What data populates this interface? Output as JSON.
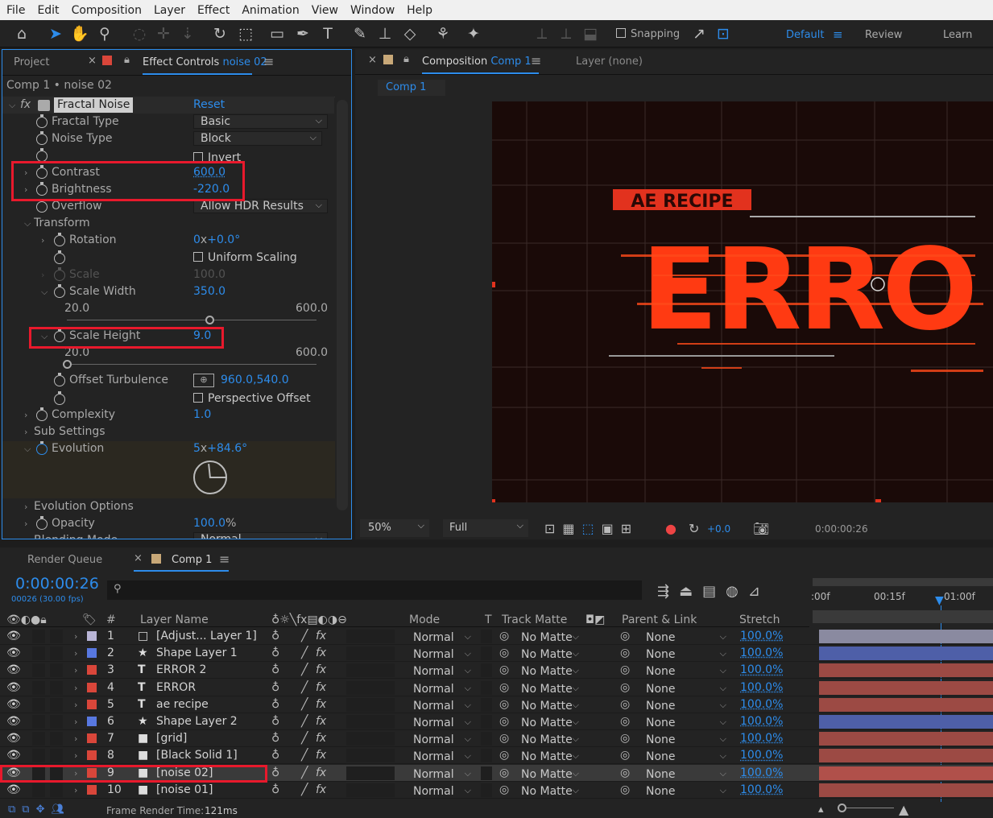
{
  "menu": [
    "File",
    "Edit",
    "Composition",
    "Layer",
    "Effect",
    "Animation",
    "View",
    "Window",
    "Help"
  ],
  "toolbar": {
    "snapping": "Snapping",
    "workspaces": [
      "Default",
      "Review",
      "Learn"
    ]
  },
  "effect_controls": {
    "project_tab": "Project",
    "tab_label": "Effect Controls",
    "tab_layer": "noise 02",
    "breadcrumb": "Comp 1 • noise 02",
    "effect_name": "Fractal Noise",
    "reset": "Reset",
    "fractal_type_label": "Fractal Type",
    "fractal_type_value": "Basic",
    "noise_type_label": "Noise Type",
    "noise_type_value": "Block",
    "invert_label": "Invert",
    "contrast_label": "Contrast",
    "contrast_value": "600.0",
    "brightness_label": "Brightness",
    "brightness_value": "-220.0",
    "overflow_label": "Overflow",
    "overflow_value": "Allow HDR Results",
    "transform_label": "Transform",
    "rotation_label": "Rotation",
    "rotation_value_a": "0",
    "rotation_value_x": "x",
    "rotation_value_b": "+0.0",
    "rotation_deg": "°",
    "uniform_scaling_label": "Uniform Scaling",
    "scale_label": "Scale",
    "scale_value": "100.0",
    "scale_width_label": "Scale Width",
    "scale_width_value": "350.0",
    "sw_min": "20.0",
    "sw_max": "600.0",
    "sw_level": 0.57,
    "scale_height_label": "Scale Height",
    "scale_height_value": "9.0",
    "sh_min": "20.0",
    "sh_max": "600.0",
    "sh_level": 0.0,
    "offset_label": "Offset Turbulence",
    "offset_value": "960.0,540.0",
    "perspective_label": "Perspective Offset",
    "complexity_label": "Complexity",
    "complexity_value": "1.0",
    "sub_settings_label": "Sub Settings",
    "evolution_label": "Evolution",
    "evolution_value_a": "5",
    "evolution_value_x": "x",
    "evolution_value_b": "+84.6",
    "evolution_deg": "°",
    "evolution_options_label": "Evolution Options",
    "opacity_label": "Opacity",
    "opacity_value": "100.0",
    "opacity_unit": "%",
    "blending_label": "Blending Mode",
    "blending_value": "Normal"
  },
  "composition": {
    "tab_label": "Composition",
    "tab_comp": "Comp 1",
    "layer_label": "Layer (none)",
    "crumb": "Comp 1",
    "viewer_text_small": "AE RECIPE",
    "viewer_text_big": "ERRO",
    "zoom": "50%",
    "resolution": "Full",
    "exposure": "+0.0",
    "timecode": "0:00:00:26"
  },
  "timeline": {
    "render_queue": "Render Queue",
    "comp_tab": "Comp 1",
    "timecode": "0:00:00:26",
    "frames": "00026 (30.00 fps)",
    "search_placeholder": "",
    "ruler": [
      ":00f",
      "00:15f",
      "01:00f"
    ],
    "headers": {
      "num": "#",
      "name": "Layer Name",
      "mode": "Mode",
      "t": "T",
      "matte": "Track Matte",
      "parent": "Parent & Link",
      "stretch": "Stretch"
    },
    "footer": "Frame Render Time:",
    "footer_ms": "121ms",
    "layers": [
      {
        "num": "1",
        "name": "[Adjust... Layer 1]",
        "icon": "□",
        "color": "#b9b5d6",
        "mode": "Normal",
        "matte": "No Matte",
        "parent": "None",
        "stretch": "100.0%",
        "bar": "#8a8aa0"
      },
      {
        "num": "2",
        "name": "Shape Layer 1",
        "icon": "★",
        "color": "#5878e0",
        "mode": "Normal",
        "matte": "No Matte",
        "parent": "None",
        "stretch": "100.0%",
        "bar": "#4e5fa8"
      },
      {
        "num": "3",
        "name": "ERROR 2",
        "icon": "T",
        "color": "#d9463a",
        "mode": "Normal",
        "matte": "No Matte",
        "parent": "None",
        "stretch": "100.0%",
        "bar": "#9c4a44"
      },
      {
        "num": "4",
        "name": "ERROR",
        "icon": "T",
        "color": "#d9463a",
        "mode": "Normal",
        "matte": "No Matte",
        "parent": "None",
        "stretch": "100.0%",
        "bar": "#9c4a44"
      },
      {
        "num": "5",
        "name": "ae recipe",
        "icon": "T",
        "color": "#d9463a",
        "mode": "Normal",
        "matte": "No Matte",
        "parent": "None",
        "stretch": "100.0%",
        "bar": "#9c4a44"
      },
      {
        "num": "6",
        "name": "Shape Layer 2",
        "icon": "★",
        "color": "#5878e0",
        "mode": "Normal",
        "matte": "No Matte",
        "parent": "None",
        "stretch": "100.0%",
        "bar": "#4e5fa8"
      },
      {
        "num": "7",
        "name": "[grid]",
        "icon": "■",
        "color": "#d9463a",
        "mode": "Normal",
        "matte": "No Matte",
        "parent": "None",
        "stretch": "100.0%",
        "bar": "#9c4a44"
      },
      {
        "num": "8",
        "name": "[Black Solid 1]",
        "icon": "■",
        "color": "#d9463a",
        "mode": "Normal",
        "matte": "No Matte",
        "parent": "None",
        "stretch": "100.0%",
        "bar": "#9c4a44"
      },
      {
        "num": "9",
        "name": "[noise 02]",
        "icon": "■",
        "color": "#d9463a",
        "mode": "Normal",
        "matte": "No Matte",
        "parent": "None",
        "stretch": "100.0%",
        "bar": "#b0504a"
      },
      {
        "num": "10",
        "name": "[noise 01]",
        "icon": "■",
        "color": "#d9463a",
        "mode": "Normal",
        "matte": "No Matte",
        "parent": "None",
        "stretch": "100.0%",
        "bar": "#9c4a44"
      }
    ]
  }
}
